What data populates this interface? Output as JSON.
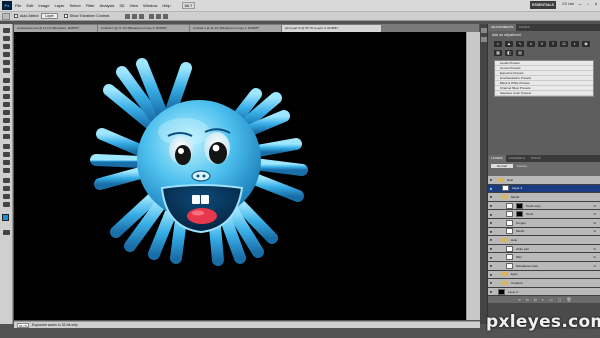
{
  "menubar": {
    "logo": "Ps",
    "items": [
      "File",
      "Edit",
      "Image",
      "Layer",
      "Select",
      "Filter",
      "Analysis",
      "3D",
      "View",
      "Window",
      "Help"
    ],
    "zoom": "66.7",
    "essentials": "ESSENTIALS",
    "cs_live": "CS Live"
  },
  "optionsbar": {
    "auto_select_label": "Auto-Select:",
    "auto_select_value": "Layer",
    "transform_label": "Show Transform Controls"
  },
  "doc_tabs": [
    {
      "label": "pixelstolove.psd @ 11.1% (Ebroidere, RGB/8*)",
      "active": false
    },
    {
      "label": "Untitled-1 @ 11.1% (Background copy 2, RGB/8*)",
      "active": false
    },
    {
      "label": "Untitled-1 @ 11.1% (Background copy 2, RGB/8*)",
      "active": false
    },
    {
      "label": "pkmnyart.tif @ 66.7% (Layer 0, RGB/8*)",
      "active": true
    }
  ],
  "statusbar": {
    "zoom": "66.7%",
    "info": "Exposure works in 32-bit only"
  },
  "panels": {
    "top_tabs": [
      "LAYERS",
      "CHANNELS",
      "PATHS"
    ],
    "adj_tabs": [
      "ADJUSTMENTS",
      "MASKS"
    ],
    "adj_title": "Add an adjustment",
    "presets": [
      "Levels Presets",
      "Curves Presets",
      "Exposure Presets",
      "Hue/Saturation Presets",
      "Black & White Presets",
      "Channel Mixer Presets",
      "Selective Color Presets"
    ],
    "layers_tabs": [
      "LAYERS",
      "CHANNELS",
      "PATHS"
    ],
    "blend_mode": "Normal",
    "opacity_label": "Opacity:",
    "layers": [
      {
        "name": "Hole",
        "type": "group",
        "selected": false,
        "indent": 1
      },
      {
        "name": "Layer 3",
        "type": "layer",
        "selected": true,
        "indent": 2
      },
      {
        "name": "Mouth",
        "type": "group",
        "selected": false,
        "indent": 2
      },
      {
        "name": "Tooth copy",
        "type": "mask",
        "selected": false,
        "indent": 3,
        "fx": "fx"
      },
      {
        "name": "Tooth",
        "type": "mask",
        "selected": false,
        "indent": 3,
        "fx": "fx"
      },
      {
        "name": "Tongue",
        "type": "layer",
        "selected": false,
        "indent": 3,
        "fx": "fx"
      },
      {
        "name": "Mouth",
        "type": "layer",
        "selected": false,
        "indent": 3,
        "fx": "fx"
      },
      {
        "name": "Hole",
        "type": "group",
        "selected": false,
        "indent": 2
      },
      {
        "name": "white part",
        "type": "layer",
        "selected": false,
        "indent": 3,
        "fx": "fx"
      },
      {
        "name": "Skin",
        "type": "layer",
        "selected": false,
        "indent": 3,
        "fx": "fx"
      },
      {
        "name": "Shoulderer rules",
        "type": "layer",
        "selected": false,
        "indent": 3,
        "fx": "fx"
      },
      {
        "name": "Eyes",
        "type": "group",
        "selected": false,
        "indent": 2
      },
      {
        "name": "Creature",
        "type": "group",
        "selected": false,
        "indent": 2
      },
      {
        "name": "Layer 0",
        "type": "black",
        "selected": false,
        "indent": 1
      }
    ]
  },
  "watermark": "pxleyes.com"
}
